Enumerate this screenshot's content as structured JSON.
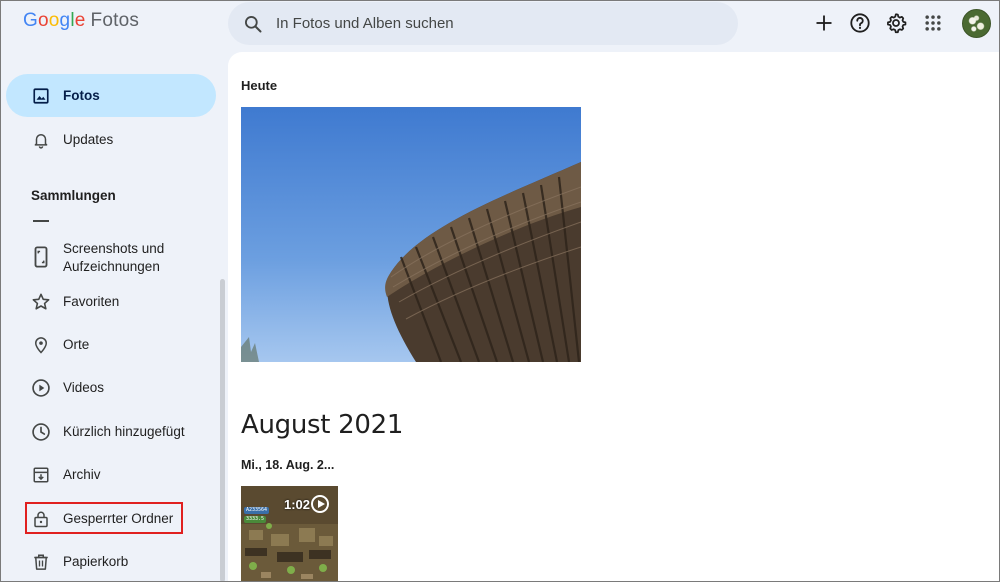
{
  "app": {
    "logo_parts": [
      "G",
      "o",
      "o",
      "g",
      "l",
      "e"
    ],
    "product": "Fotos"
  },
  "search": {
    "placeholder": "In Fotos und Alben suchen"
  },
  "header_icons": [
    "add-icon",
    "help-icon",
    "settings-icon",
    "apps-icon",
    "avatar"
  ],
  "sidebar": {
    "items": [
      {
        "label": "Fotos",
        "icon": "photo-icon",
        "active": true
      },
      {
        "label": "Updates",
        "icon": "bell-icon"
      }
    ],
    "section_title": "Sammlungen",
    "collections": [
      {
        "label": "Screenshots und\nAufzeichnungen",
        "line1": "Screenshots und",
        "line2": "Aufzeichnungen",
        "icon": "screenshot-icon"
      },
      {
        "label": "Favoriten",
        "icon": "star-icon"
      },
      {
        "label": "Orte",
        "icon": "location-icon"
      },
      {
        "label": "Videos",
        "icon": "play-circle-icon"
      },
      {
        "label": "Kürzlich hinzugefügt",
        "icon": "clock-icon"
      },
      {
        "label": "Archiv",
        "icon": "archive-icon"
      },
      {
        "label": "Gesperrter Ordner",
        "icon": "lock-icon",
        "highlighted": true
      },
      {
        "label": "Papierkorb",
        "icon": "trash-icon"
      }
    ]
  },
  "main": {
    "groups": [
      {
        "title": "Heute"
      },
      {
        "month": "August 2021",
        "date": "Mi., 18. Aug. 2...",
        "video_duration": "1:02",
        "video_badges": [
          "A233564",
          "3333.5"
        ]
      }
    ]
  },
  "colors": {
    "background": "#eef2f9",
    "active_nav": "#c2e7ff",
    "highlight_box": "#e02020",
    "search_bg": "#e3e9f3"
  }
}
